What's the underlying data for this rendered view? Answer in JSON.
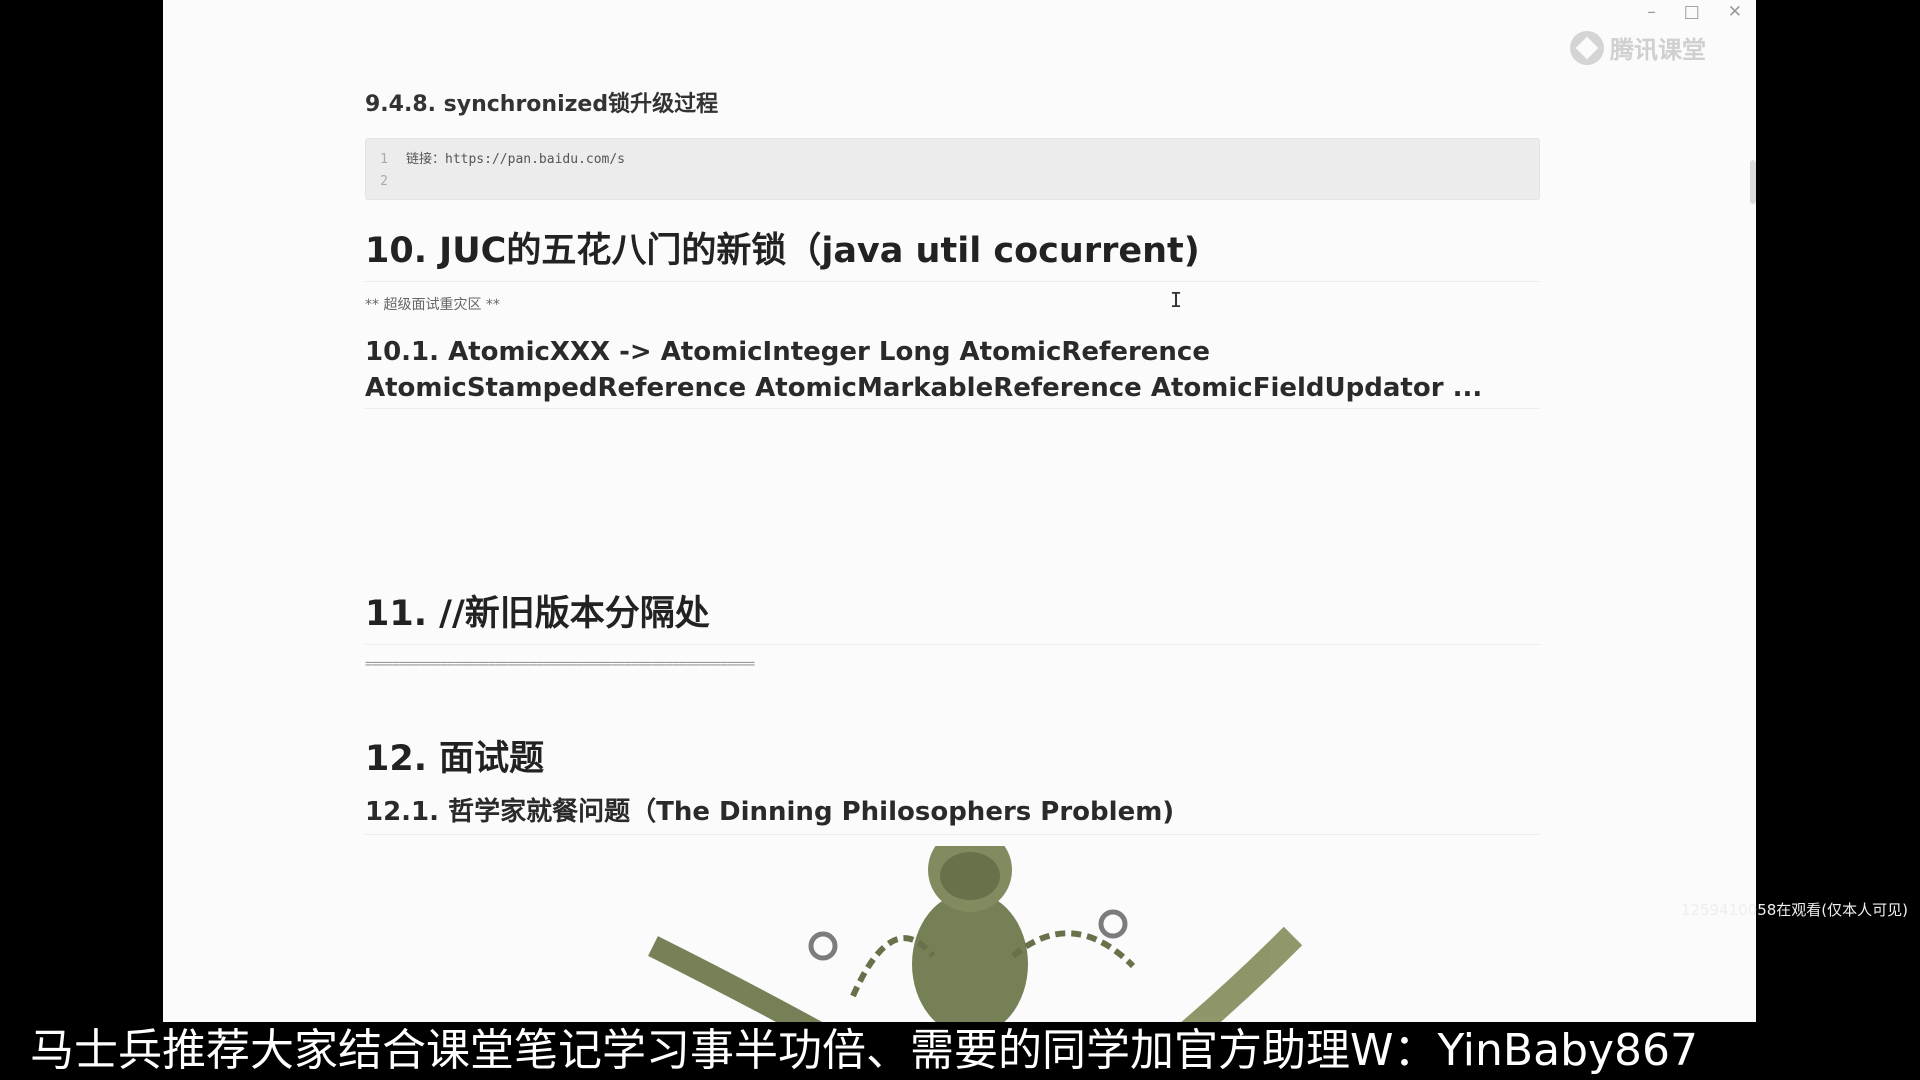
{
  "window": {
    "controls": [
      "–",
      "□",
      "✕"
    ]
  },
  "logo": {
    "text": "腾讯课堂",
    "icon": "tencent-classroom-icon"
  },
  "doc": {
    "h_948": "9.4.8. synchronized锁升级过程",
    "code": {
      "lines": [
        {
          "num": "1",
          "text": "链接：https://pan.baidu.com/s"
        },
        {
          "num": "2",
          "text": ""
        }
      ]
    },
    "h_10": "10. JUC的五花八门的新锁（java util cocurrent)",
    "note_10": "** 超级面试重灾区 **",
    "h_101_line1": "10.1. AtomicXXX -> AtomicInteger Long AtomicReference",
    "h_101_line2": "AtomicStampedReference AtomicMarkableReference AtomicFieldUpdator ...",
    "h_11": "11. //新旧版本分隔处",
    "separator": "=========================================================",
    "h_12": "12. 面试题",
    "h_121": "12.1. 哲学家就餐问题（The Dinning Philosophers Problem)"
  },
  "cursor": "I",
  "viewer_text": "1259410058在观看(仅本人可见)",
  "subtitle": "马士兵推荐大家结合课堂笔记学习事半功倍、需要的同学加官方助理W：YinBaby867"
}
